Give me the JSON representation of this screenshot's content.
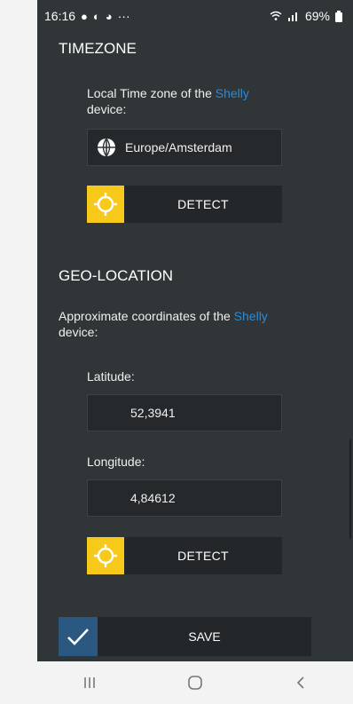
{
  "status_bar": {
    "time": "16:16",
    "more_indicator": "···",
    "battery_text": "69%"
  },
  "timezone": {
    "section_title": "TIMEZONE",
    "label_prefix": "Local Time zone of the ",
    "label_accent": "Shelly",
    "label_suffix": " device:",
    "value": "Europe/Amsterdam",
    "detect_label": "DETECT"
  },
  "geo": {
    "section_title": "GEO-LOCATION",
    "label_prefix": "Approximate coordinates of the ",
    "label_accent": "Shelly",
    "label_suffix": " device:",
    "latitude_label": "Latitude:",
    "latitude_value": "52,3941",
    "longitude_label": "Longitude:",
    "longitude_value": "4,84612",
    "detect_label": "DETECT"
  },
  "save_label": "SAVE",
  "colors": {
    "background": "#303538",
    "accent": "#2c8ad6",
    "detect": "#f6c91a",
    "save": "#2a5880"
  }
}
